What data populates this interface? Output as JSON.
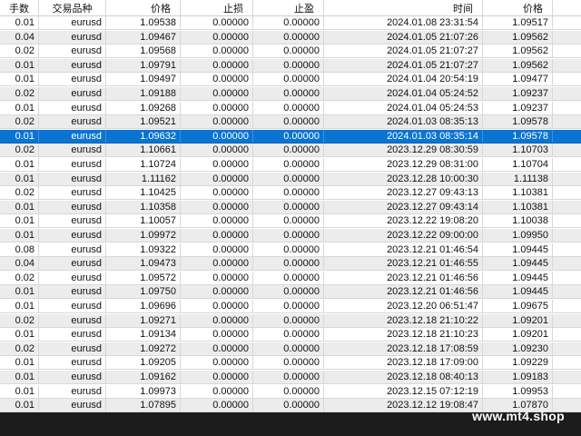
{
  "columns": [
    "手数",
    "交易品种",
    "价格",
    "止损",
    "止盈",
    "时间",
    "价格"
  ],
  "selected_row_index": 8,
  "rows": [
    [
      "0.01",
      "eurusd",
      "1.09538",
      "0.00000",
      "0.00000",
      "2024.01.08 23:31:54",
      "1.09517"
    ],
    [
      "0.04",
      "eurusd",
      "1.09467",
      "0.00000",
      "0.00000",
      "2024.01.05 21:07:26",
      "1.09562"
    ],
    [
      "0.02",
      "eurusd",
      "1.09568",
      "0.00000",
      "0.00000",
      "2024.01.05 21:07:27",
      "1.09562"
    ],
    [
      "0.01",
      "eurusd",
      "1.09791",
      "0.00000",
      "0.00000",
      "2024.01.05 21:07:27",
      "1.09562"
    ],
    [
      "0.01",
      "eurusd",
      "1.09497",
      "0.00000",
      "0.00000",
      "2024.01.04 20:54:19",
      "1.09477"
    ],
    [
      "0.02",
      "eurusd",
      "1.09188",
      "0.00000",
      "0.00000",
      "2024.01.04 05:24:52",
      "1.09237"
    ],
    [
      "0.01",
      "eurusd",
      "1.09268",
      "0.00000",
      "0.00000",
      "2024.01.04 05:24:53",
      "1.09237"
    ],
    [
      "0.02",
      "eurusd",
      "1.09521",
      "0.00000",
      "0.00000",
      "2024.01.03 08:35:13",
      "1.09578"
    ],
    [
      "0.01",
      "eurusd",
      "1.09632",
      "0.00000",
      "0.00000",
      "2024.01.03 08:35:14",
      "1.09578"
    ],
    [
      "0.02",
      "eurusd",
      "1.10661",
      "0.00000",
      "0.00000",
      "2023.12.29 08:30:59",
      "1.10703"
    ],
    [
      "0.01",
      "eurusd",
      "1.10724",
      "0.00000",
      "0.00000",
      "2023.12.29 08:31:00",
      "1.10704"
    ],
    [
      "0.01",
      "eurusd",
      "1.11162",
      "0.00000",
      "0.00000",
      "2023.12.28 10:00:30",
      "1.11138"
    ],
    [
      "0.02",
      "eurusd",
      "1.10425",
      "0.00000",
      "0.00000",
      "2023.12.27 09:43:13",
      "1.10381"
    ],
    [
      "0.01",
      "eurusd",
      "1.10358",
      "0.00000",
      "0.00000",
      "2023.12.27 09:43:14",
      "1.10381"
    ],
    [
      "0.01",
      "eurusd",
      "1.10057",
      "0.00000",
      "0.00000",
      "2023.12.22 19:08:20",
      "1.10038"
    ],
    [
      "0.01",
      "eurusd",
      "1.09972",
      "0.00000",
      "0.00000",
      "2023.12.22 09:00:00",
      "1.09950"
    ],
    [
      "0.08",
      "eurusd",
      "1.09322",
      "0.00000",
      "0.00000",
      "2023.12.21 01:46:54",
      "1.09445"
    ],
    [
      "0.04",
      "eurusd",
      "1.09473",
      "0.00000",
      "0.00000",
      "2023.12.21 01:46:55",
      "1.09445"
    ],
    [
      "0.02",
      "eurusd",
      "1.09572",
      "0.00000",
      "0.00000",
      "2023.12.21 01:46:56",
      "1.09445"
    ],
    [
      "0.01",
      "eurusd",
      "1.09750",
      "0.00000",
      "0.00000",
      "2023.12.21 01:46:56",
      "1.09445"
    ],
    [
      "0.01",
      "eurusd",
      "1.09696",
      "0.00000",
      "0.00000",
      "2023.12.20 06:51:47",
      "1.09675"
    ],
    [
      "0.02",
      "eurusd",
      "1.09271",
      "0.00000",
      "0.00000",
      "2023.12.18 21:10:22",
      "1.09201"
    ],
    [
      "0.01",
      "eurusd",
      "1.09134",
      "0.00000",
      "0.00000",
      "2023.12.18 21:10:23",
      "1.09201"
    ],
    [
      "0.02",
      "eurusd",
      "1.09272",
      "0.00000",
      "0.00000",
      "2023.12.18 17:08:59",
      "1.09230"
    ],
    [
      "0.01",
      "eurusd",
      "1.09205",
      "0.00000",
      "0.00000",
      "2023.12.18 17:09:00",
      "1.09229"
    ],
    [
      "0.01",
      "eurusd",
      "1.09162",
      "0.00000",
      "0.00000",
      "2023.12.18 08:40:13",
      "1.09183"
    ],
    [
      "0.01",
      "eurusd",
      "1.09973",
      "0.00000",
      "0.00000",
      "2023.12.15 07:12:19",
      "1.09953"
    ],
    [
      "0.01",
      "eurusd",
      "1.07895",
      "0.00000",
      "0.00000",
      "2023.12.12 19:08:47",
      "1.07870"
    ]
  ],
  "watermark": "www.mt4.shop"
}
